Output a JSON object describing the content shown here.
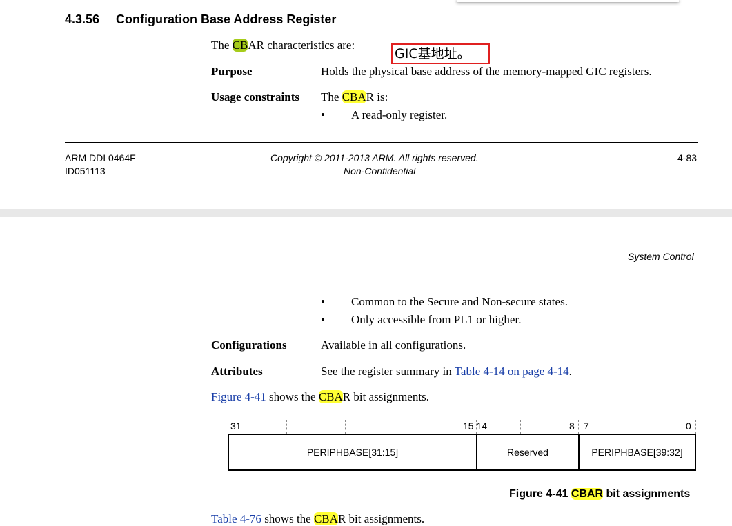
{
  "section": {
    "number": "4.3.56",
    "title": "Configuration Base Address Register"
  },
  "intro": {
    "pre": "The ",
    "hl": "CB",
    "post": "AR characteristics are:"
  },
  "annotation": "GIC基地址。",
  "purpose": {
    "label": "Purpose",
    "text": "Holds the physical base address of the memory-mapped GIC registers."
  },
  "usage": {
    "label": "Usage constraints",
    "pre": "The ",
    "hl": "CBA",
    "post": "R is:",
    "bullets": [
      "A read-only register."
    ]
  },
  "footer": {
    "doc_id": "ARM DDI 0464F",
    "doc_rev": "ID051113",
    "copyright": "Copyright © 2011-2013 ARM. All rights reserved.",
    "confidentiality": "Non-Confidential",
    "page": "4-83"
  },
  "header2": "System Control",
  "usage_cont_bullets": [
    "Common to the Secure and Non-secure states.",
    "Only accessible from PL1 or higher."
  ],
  "configurations": {
    "label": "Configurations",
    "text": "Available in all configurations."
  },
  "attributes": {
    "label": "Attributes",
    "text": "See the register summary in ",
    "link": "Table 4-14 on page 4-14",
    "end": "."
  },
  "fig_ref": {
    "link": "Figure 4-41",
    "mid": " shows the ",
    "hl": "CBA",
    "post": "R bit assignments."
  },
  "register": {
    "bits": [
      "31",
      "15 14",
      "8",
      "7",
      "0"
    ],
    "fields": [
      "PERIPHBASE[31:15]",
      "Reserved",
      "PERIPHBASE[39:32]"
    ]
  },
  "figure_caption": {
    "pre": "Figure 4-41 ",
    "hl": "CBAR",
    "post": " bit assignments"
  },
  "table_ref": {
    "link": "Table 4-76",
    "mid": " shows the ",
    "hl": "CBA",
    "post": "R bit assignments."
  }
}
